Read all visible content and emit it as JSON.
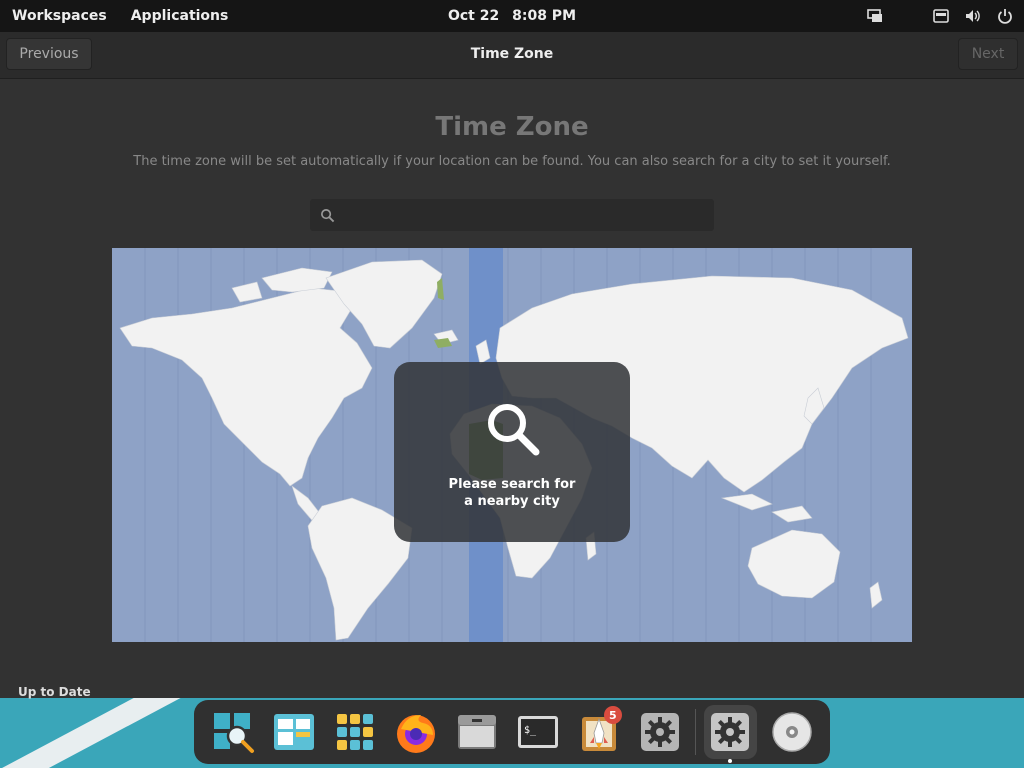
{
  "panel": {
    "workspaces": "Workspaces",
    "applications": "Applications",
    "date": "Oct 22",
    "time": "8:08 PM",
    "tray": [
      "display-icon",
      "keyboard-icon",
      "volume-icon",
      "power-icon"
    ]
  },
  "header": {
    "previous": "Previous",
    "title": "Time Zone",
    "next": "Next"
  },
  "main": {
    "title": "Time Zone",
    "description": "The time zone will be set automatically if your location can be found. You can also search for a city to set it yourself.",
    "search": {
      "value": "",
      "placeholder": ""
    },
    "map": {
      "selected_zone_color": "#6f90c9",
      "land_color": "#f2f2f2",
      "ocean_color": "#8ea2c6"
    },
    "overlay": {
      "icon": "search-icon",
      "text": "Please search for a nearby city"
    }
  },
  "status": "Up to Date",
  "dock": {
    "items": [
      {
        "name": "magnifier",
        "icon": "magnifier-icon"
      },
      {
        "name": "multitasking",
        "icon": "window-view-icon"
      },
      {
        "name": "applications",
        "icon": "app-grid-icon"
      },
      {
        "name": "firefox",
        "icon": "firefox-icon"
      },
      {
        "name": "files",
        "icon": "files-icon"
      },
      {
        "name": "terminal",
        "icon": "terminal-icon"
      },
      {
        "name": "appcenter",
        "icon": "appcenter-icon",
        "badge": "5"
      },
      {
        "name": "settings",
        "icon": "settings-icon"
      },
      {
        "name": "installer-settings",
        "icon": "settings-icon"
      },
      {
        "name": "disc",
        "icon": "disc-icon"
      }
    ]
  }
}
